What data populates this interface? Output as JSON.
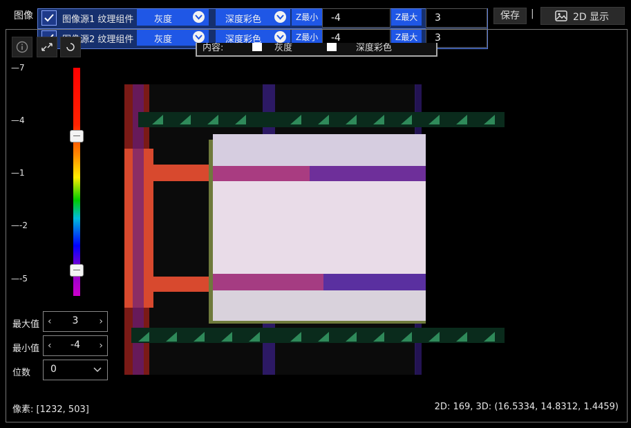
{
  "title": "图像",
  "sources": [
    {
      "label": "图像源1 纹理组件",
      "checked": true,
      "mode": "灰度",
      "color_mode": "深度彩色",
      "zmin_label": "Z最小",
      "zmin": "-4",
      "zmax_label": "Z最大",
      "zmax": "3"
    },
    {
      "label": "图像源2 纹理组件",
      "checked": true,
      "mode": "灰度",
      "color_mode": "深度彩色",
      "zmin_label": "Z最小",
      "zmin": "-4",
      "zmax_label": "Z最大",
      "zmax": "3"
    }
  ],
  "toolbar": {
    "save_label": "保存",
    "separator": "|",
    "display_label": "2D 显示"
  },
  "overlay": {
    "content_label": "内容:",
    "gray_label": "灰度",
    "depth_label": "深度彩色"
  },
  "scale": {
    "ticks": [
      "7",
      "4",
      "1",
      "-2",
      "-5"
    ]
  },
  "controls": {
    "max_label": "最大值",
    "max_value": "3",
    "min_label": "最小值",
    "min_value": "-4",
    "digits_label": "位数",
    "digits_value": "0"
  },
  "status": {
    "pixel": "像素: [1232, 503]",
    "coords": "2D: 169, 3D: (16.5334, 14.8312, 1.4459)"
  },
  "colors": {
    "accent": "#1f57e6",
    "panel_border": "#777777",
    "background": "#000000"
  }
}
